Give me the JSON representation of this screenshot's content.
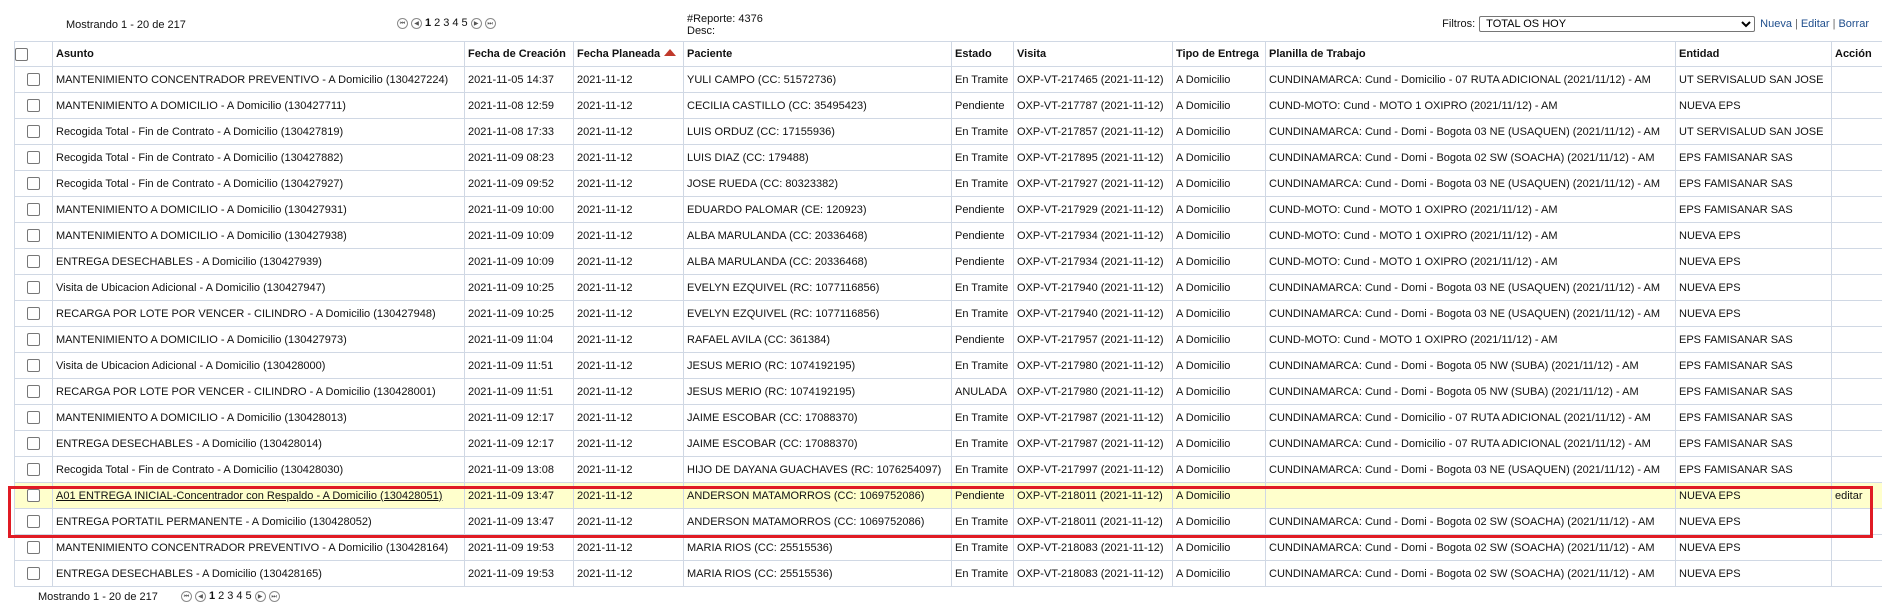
{
  "pager_top": {
    "showing": "Mostrando 1 - 20 de 217",
    "pages": [
      "1",
      "2",
      "3",
      "4",
      "5"
    ],
    "current": "1"
  },
  "pager_bottom": {
    "showing": "Mostrando 1 - 20 de 217",
    "pages": [
      "1",
      "2",
      "3",
      "4",
      "5"
    ],
    "current": "1"
  },
  "report": {
    "number_text": "#Reporte: 4376",
    "desc_text": "Desc:"
  },
  "filters": {
    "label": "Filtros:",
    "selected": "TOTAL OS HOY",
    "nueva": "Nueva",
    "editar": "Editar",
    "borrar": "Borrar",
    "separator": "|"
  },
  "table": {
    "headers": {
      "asunto": "Asunto",
      "fecha_creacion": "Fecha de Creación",
      "fecha_planeada": "Fecha Planeada",
      "paciente": "Paciente",
      "estado": "Estado",
      "visita": "Visita",
      "tipo_entrega": "Tipo de Entrega",
      "planilla": "Planilla de Trabajo",
      "entidad": "Entidad",
      "accion": "Acción"
    },
    "sort": {
      "column": "Fecha Planeada",
      "direction": "ascending"
    },
    "rows": [
      {
        "asunto": "MANTENIMIENTO CONCENTRADOR PREVENTIVO - A Domicilio (130427224)",
        "fecha_creacion": "2021-11-05 14:37",
        "fecha_planeada": "2021-11-12",
        "paciente": "YULI CAMPO (CC: 51572736)",
        "estado": "En Tramite",
        "visita": "OXP-VT-217465 (2021-11-12)",
        "tipo_entrega": "A Domicilio",
        "planilla": "CUNDINAMARCA: Cund - Domicilio - 07 RUTA ADICIONAL (2021/11/12) - AM",
        "entidad": "UT SERVISALUD SAN JOSE",
        "accion": ""
      },
      {
        "asunto": "MANTENIMIENTO A DOMICILIO - A Domicilio (130427711)",
        "fecha_creacion": "2021-11-08 12:59",
        "fecha_planeada": "2021-11-12",
        "paciente": "CECILIA CASTILLO (CC: 35495423)",
        "estado": "Pendiente",
        "visita": "OXP-VT-217787 (2021-11-12)",
        "tipo_entrega": "A Domicilio",
        "planilla": "CUND-MOTO: Cund - MOTO 1 OXIPRO (2021/11/12) - AM",
        "entidad": "NUEVA EPS",
        "accion": ""
      },
      {
        "asunto": "Recogida Total - Fin de Contrato - A Domicilio (130427819)",
        "fecha_creacion": "2021-11-08 17:33",
        "fecha_planeada": "2021-11-12",
        "paciente": "LUIS ORDUZ (CC: 17155936)",
        "estado": "En Tramite",
        "visita": "OXP-VT-217857 (2021-11-12)",
        "tipo_entrega": "A Domicilio",
        "planilla": "CUNDINAMARCA: Cund - Domi - Bogota 03 NE (USAQUEN) (2021/11/12) - AM",
        "entidad": "UT SERVISALUD SAN JOSE",
        "accion": ""
      },
      {
        "asunto": "Recogida Total - Fin de Contrato - A Domicilio (130427882)",
        "fecha_creacion": "2021-11-09 08:23",
        "fecha_planeada": "2021-11-12",
        "paciente": "LUIS DIAZ (CC: 179488)",
        "estado": "En Tramite",
        "visita": "OXP-VT-217895 (2021-11-12)",
        "tipo_entrega": "A Domicilio",
        "planilla": "CUNDINAMARCA: Cund - Domi - Bogota 02 SW (SOACHA) (2021/11/12) - AM",
        "entidad": "EPS FAMISANAR SAS",
        "accion": ""
      },
      {
        "asunto": "Recogida Total - Fin de Contrato - A Domicilio (130427927)",
        "fecha_creacion": "2021-11-09 09:52",
        "fecha_planeada": "2021-11-12",
        "paciente": "JOSE RUEDA (CC: 80323382)",
        "estado": "En Tramite",
        "visita": "OXP-VT-217927 (2021-11-12)",
        "tipo_entrega": "A Domicilio",
        "planilla": "CUNDINAMARCA: Cund - Domi - Bogota 03 NE (USAQUEN) (2021/11/12) - AM",
        "entidad": "EPS FAMISANAR SAS",
        "accion": ""
      },
      {
        "asunto": "MANTENIMIENTO A DOMICILIO - A Domicilio (130427931)",
        "fecha_creacion": "2021-11-09 10:00",
        "fecha_planeada": "2021-11-12",
        "paciente": "EDUARDO PALOMAR (CE: 120923)",
        "estado": "Pendiente",
        "visita": "OXP-VT-217929 (2021-11-12)",
        "tipo_entrega": "A Domicilio",
        "planilla": "CUND-MOTO: Cund - MOTO 1 OXIPRO (2021/11/12) - AM",
        "entidad": "EPS FAMISANAR SAS",
        "accion": ""
      },
      {
        "asunto": "MANTENIMIENTO A DOMICILIO - A Domicilio (130427938)",
        "fecha_creacion": "2021-11-09 10:09",
        "fecha_planeada": "2021-11-12",
        "paciente": "ALBA MARULANDA (CC: 20336468)",
        "estado": "Pendiente",
        "visita": "OXP-VT-217934 (2021-11-12)",
        "tipo_entrega": "A Domicilio",
        "planilla": "CUND-MOTO: Cund - MOTO 1 OXIPRO (2021/11/12) - AM",
        "entidad": "NUEVA EPS",
        "accion": ""
      },
      {
        "asunto": "ENTREGA DESECHABLES - A Domicilio (130427939)",
        "fecha_creacion": "2021-11-09 10:09",
        "fecha_planeada": "2021-11-12",
        "paciente": "ALBA MARULANDA (CC: 20336468)",
        "estado": "Pendiente",
        "visita": "OXP-VT-217934 (2021-11-12)",
        "tipo_entrega": "A Domicilio",
        "planilla": "CUND-MOTO: Cund - MOTO 1 OXIPRO (2021/11/12) - AM",
        "entidad": "NUEVA EPS",
        "accion": ""
      },
      {
        "asunto": "Visita de Ubicacion Adicional - A Domicilio (130427947)",
        "fecha_creacion": "2021-11-09 10:25",
        "fecha_planeada": "2021-11-12",
        "paciente": "EVELYN EZQUIVEL (RC: 1077116856)",
        "estado": "En Tramite",
        "visita": "OXP-VT-217940 (2021-11-12)",
        "tipo_entrega": "A Domicilio",
        "planilla": "CUNDINAMARCA: Cund - Domi - Bogota 03 NE (USAQUEN) (2021/11/12) - AM",
        "entidad": "NUEVA EPS",
        "accion": ""
      },
      {
        "asunto": "RECARGA POR LOTE POR VENCER - CILINDRO - A Domicilio (130427948)",
        "fecha_creacion": "2021-11-09 10:25",
        "fecha_planeada": "2021-11-12",
        "paciente": "EVELYN EZQUIVEL (RC: 1077116856)",
        "estado": "En Tramite",
        "visita": "OXP-VT-217940 (2021-11-12)",
        "tipo_entrega": "A Domicilio",
        "planilla": "CUNDINAMARCA: Cund - Domi - Bogota 03 NE (USAQUEN) (2021/11/12) - AM",
        "entidad": "NUEVA EPS",
        "accion": ""
      },
      {
        "asunto": "MANTENIMIENTO A DOMICILIO - A Domicilio (130427973)",
        "fecha_creacion": "2021-11-09 11:04",
        "fecha_planeada": "2021-11-12",
        "paciente": "RAFAEL AVILA (CC: 361384)",
        "estado": "Pendiente",
        "visita": "OXP-VT-217957 (2021-11-12)",
        "tipo_entrega": "A Domicilio",
        "planilla": "CUND-MOTO: Cund - MOTO 1 OXIPRO (2021/11/12) - AM",
        "entidad": "EPS FAMISANAR SAS",
        "accion": ""
      },
      {
        "asunto": "Visita de Ubicacion Adicional - A Domicilio (130428000)",
        "fecha_creacion": "2021-11-09 11:51",
        "fecha_planeada": "2021-11-12",
        "paciente": "JESUS MERIO (RC: 1074192195)",
        "estado": "En Tramite",
        "visita": "OXP-VT-217980 (2021-11-12)",
        "tipo_entrega": "A Domicilio",
        "planilla": "CUNDINAMARCA: Cund - Domi - Bogota 05 NW (SUBA) (2021/11/12) - AM",
        "entidad": "EPS FAMISANAR SAS",
        "accion": ""
      },
      {
        "asunto": "RECARGA POR LOTE POR VENCER - CILINDRO - A Domicilio (130428001)",
        "fecha_creacion": "2021-11-09 11:51",
        "fecha_planeada": "2021-11-12",
        "paciente": "JESUS MERIO (RC: 1074192195)",
        "estado": "ANULADA",
        "visita": "OXP-VT-217980 (2021-11-12)",
        "tipo_entrega": "A Domicilio",
        "planilla": "CUNDINAMARCA: Cund - Domi - Bogota 05 NW (SUBA) (2021/11/12) - AM",
        "entidad": "EPS FAMISANAR SAS",
        "accion": ""
      },
      {
        "asunto": "MANTENIMIENTO A DOMICILIO - A Domicilio (130428013)",
        "fecha_creacion": "2021-11-09 12:17",
        "fecha_planeada": "2021-11-12",
        "paciente": "JAIME ESCOBAR (CC: 17088370)",
        "estado": "En Tramite",
        "visita": "OXP-VT-217987 (2021-11-12)",
        "tipo_entrega": "A Domicilio",
        "planilla": "CUNDINAMARCA: Cund - Domicilio - 07 RUTA ADICIONAL (2021/11/12) - AM",
        "entidad": "EPS FAMISANAR SAS",
        "accion": ""
      },
      {
        "asunto": "ENTREGA DESECHABLES - A Domicilio (130428014)",
        "fecha_creacion": "2021-11-09 12:17",
        "fecha_planeada": "2021-11-12",
        "paciente": "JAIME ESCOBAR (CC: 17088370)",
        "estado": "En Tramite",
        "visita": "OXP-VT-217987 (2021-11-12)",
        "tipo_entrega": "A Domicilio",
        "planilla": "CUNDINAMARCA: Cund - Domicilio - 07 RUTA ADICIONAL (2021/11/12) - AM",
        "entidad": "EPS FAMISANAR SAS",
        "accion": ""
      },
      {
        "asunto": "Recogida Total - Fin de Contrato - A Domicilio (130428030)",
        "fecha_creacion": "2021-11-09 13:08",
        "fecha_planeada": "2021-11-12",
        "paciente": "HIJO DE DAYANA GUACHAVES (RC: 1076254097)",
        "estado": "En Tramite",
        "visita": "OXP-VT-217997 (2021-11-12)",
        "tipo_entrega": "A Domicilio",
        "planilla": "CUNDINAMARCA: Cund - Domi - Bogota 03 NE (USAQUEN) (2021/11/12) - AM",
        "entidad": "EPS FAMISANAR SAS",
        "accion": ""
      },
      {
        "asunto": "A01 ENTREGA INICIAL-Concentrador con Respaldo - A Domicilio (130428051)",
        "fecha_creacion": "2021-11-09 13:47",
        "fecha_planeada": "2021-11-12",
        "paciente": "ANDERSON MATAMORROS (CC: 1069752086)",
        "estado": "Pendiente",
        "visita": "OXP-VT-218011 (2021-11-12)",
        "tipo_entrega": "A Domicilio",
        "planilla": "",
        "entidad": "NUEVA EPS",
        "accion": "editar"
      },
      {
        "asunto": "ENTREGA PORTATIL PERMANENTE - A Domicilio (130428052)",
        "fecha_creacion": "2021-11-09 13:47",
        "fecha_planeada": "2021-11-12",
        "paciente": "ANDERSON MATAMORROS (CC: 1069752086)",
        "estado": "En Tramite",
        "visita": "OXP-VT-218011 (2021-11-12)",
        "tipo_entrega": "A Domicilio",
        "planilla": "CUNDINAMARCA: Cund - Domi - Bogota 02 SW (SOACHA) (2021/11/12) - AM",
        "entidad": "NUEVA EPS",
        "accion": ""
      },
      {
        "asunto": "MANTENIMIENTO CONCENTRADOR PREVENTIVO - A Domicilio (130428164)",
        "fecha_creacion": "2021-11-09 19:53",
        "fecha_planeada": "2021-11-12",
        "paciente": "MARIA RIOS (CC: 25515536)",
        "estado": "En Tramite",
        "visita": "OXP-VT-218083 (2021-11-12)",
        "tipo_entrega": "A Domicilio",
        "planilla": "CUNDINAMARCA: Cund - Domi - Bogota 02 SW (SOACHA) (2021/11/12) - AM",
        "entidad": "NUEVA EPS",
        "accion": ""
      },
      {
        "asunto": "ENTREGA DESECHABLES - A Domicilio (130428165)",
        "fecha_creacion": "2021-11-09 19:53",
        "fecha_planeada": "2021-11-12",
        "paciente": "MARIA RIOS (CC: 25515536)",
        "estado": "En Tramite",
        "visita": "OXP-VT-218083 (2021-11-12)",
        "tipo_entrega": "A Domicilio",
        "planilla": "CUNDINAMARCA: Cund - Domi - Bogota 02 SW (SOACHA) (2021/11/12) - AM",
        "entidad": "NUEVA EPS",
        "accion": ""
      }
    ]
  },
  "highlight": {
    "hovered_row": 16,
    "row_color": "#ffffcc",
    "annotation_box_color": "#e01b24"
  },
  "icons": {
    "first": "first-page-icon",
    "prev": "prev-page-icon",
    "next": "next-page-icon",
    "last": "last-page-icon",
    "sort": "sort-ascending-icon"
  }
}
